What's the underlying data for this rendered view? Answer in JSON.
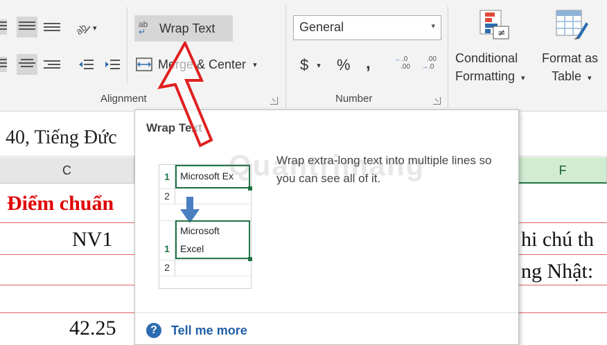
{
  "ribbon": {
    "wrap_text_label": "Wrap Text",
    "wrap_text_icon_text": "ab",
    "merge_center_label": "Merge & Center",
    "number_format": "General",
    "currency_symbol": "$",
    "percent_symbol": "%",
    "comma_symbol": ",",
    "inc_decimal_top": ".0",
    "inc_decimal_bottom": ".00",
    "dec_decimal_top": ".00",
    "dec_decimal_bottom": ".0",
    "conditional_formatting_line1": "Conditional",
    "conditional_formatting_line2": "Formatting",
    "format_as_table_line1": "Format as",
    "format_as_table_line2": "Table",
    "groups": {
      "alignment": "Alignment",
      "number": "Number"
    }
  },
  "sheet": {
    "formula_text": "40, Tiếng Đức",
    "columns": [
      {
        "label": "C"
      },
      {
        "label": "F"
      }
    ],
    "cells": {
      "c_header": "Điểm chuẩn",
      "c_row1": "NV1",
      "c_row5": "42.25",
      "f_row1": "hi chú th",
      "f_row2": "ng Nhật:"
    }
  },
  "tooltip": {
    "title": "Wrap Text",
    "description": "Wrap extra-long text into multiple lines so you can see all of it.",
    "help_link": "Tell me more",
    "watermark": "Quantrimang",
    "example": {
      "row1": "1",
      "row2": "2",
      "before_text": "Microsoft Ex",
      "after_line1": "Microsoft",
      "after_line2": "Excel"
    }
  },
  "colors": {
    "accent_green": "#217346",
    "link_blue": "#1f5fa8",
    "arrow_red": "#e02020",
    "text_red": "#e00000"
  }
}
